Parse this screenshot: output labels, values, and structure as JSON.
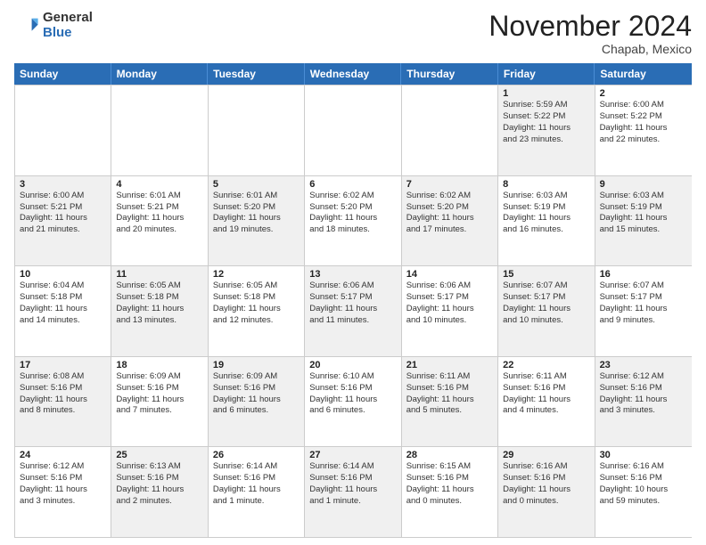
{
  "logo": {
    "general": "General",
    "blue": "Blue"
  },
  "title": "November 2024",
  "location": "Chapab, Mexico",
  "days_of_week": [
    "Sunday",
    "Monday",
    "Tuesday",
    "Wednesday",
    "Thursday",
    "Friday",
    "Saturday"
  ],
  "weeks": [
    [
      {
        "day": "",
        "info": ""
      },
      {
        "day": "",
        "info": ""
      },
      {
        "day": "",
        "info": ""
      },
      {
        "day": "",
        "info": ""
      },
      {
        "day": "",
        "info": ""
      },
      {
        "day": "1",
        "info": "Sunrise: 5:59 AM\nSunset: 5:22 PM\nDaylight: 11 hours\nand 23 minutes."
      },
      {
        "day": "2",
        "info": "Sunrise: 6:00 AM\nSunset: 5:22 PM\nDaylight: 11 hours\nand 22 minutes."
      }
    ],
    [
      {
        "day": "3",
        "info": "Sunrise: 6:00 AM\nSunset: 5:21 PM\nDaylight: 11 hours\nand 21 minutes."
      },
      {
        "day": "4",
        "info": "Sunrise: 6:01 AM\nSunset: 5:21 PM\nDaylight: 11 hours\nand 20 minutes."
      },
      {
        "day": "5",
        "info": "Sunrise: 6:01 AM\nSunset: 5:20 PM\nDaylight: 11 hours\nand 19 minutes."
      },
      {
        "day": "6",
        "info": "Sunrise: 6:02 AM\nSunset: 5:20 PM\nDaylight: 11 hours\nand 18 minutes."
      },
      {
        "day": "7",
        "info": "Sunrise: 6:02 AM\nSunset: 5:20 PM\nDaylight: 11 hours\nand 17 minutes."
      },
      {
        "day": "8",
        "info": "Sunrise: 6:03 AM\nSunset: 5:19 PM\nDaylight: 11 hours\nand 16 minutes."
      },
      {
        "day": "9",
        "info": "Sunrise: 6:03 AM\nSunset: 5:19 PM\nDaylight: 11 hours\nand 15 minutes."
      }
    ],
    [
      {
        "day": "10",
        "info": "Sunrise: 6:04 AM\nSunset: 5:18 PM\nDaylight: 11 hours\nand 14 minutes."
      },
      {
        "day": "11",
        "info": "Sunrise: 6:05 AM\nSunset: 5:18 PM\nDaylight: 11 hours\nand 13 minutes."
      },
      {
        "day": "12",
        "info": "Sunrise: 6:05 AM\nSunset: 5:18 PM\nDaylight: 11 hours\nand 12 minutes."
      },
      {
        "day": "13",
        "info": "Sunrise: 6:06 AM\nSunset: 5:17 PM\nDaylight: 11 hours\nand 11 minutes."
      },
      {
        "day": "14",
        "info": "Sunrise: 6:06 AM\nSunset: 5:17 PM\nDaylight: 11 hours\nand 10 minutes."
      },
      {
        "day": "15",
        "info": "Sunrise: 6:07 AM\nSunset: 5:17 PM\nDaylight: 11 hours\nand 10 minutes."
      },
      {
        "day": "16",
        "info": "Sunrise: 6:07 AM\nSunset: 5:17 PM\nDaylight: 11 hours\nand 9 minutes."
      }
    ],
    [
      {
        "day": "17",
        "info": "Sunrise: 6:08 AM\nSunset: 5:16 PM\nDaylight: 11 hours\nand 8 minutes."
      },
      {
        "day": "18",
        "info": "Sunrise: 6:09 AM\nSunset: 5:16 PM\nDaylight: 11 hours\nand 7 minutes."
      },
      {
        "day": "19",
        "info": "Sunrise: 6:09 AM\nSunset: 5:16 PM\nDaylight: 11 hours\nand 6 minutes."
      },
      {
        "day": "20",
        "info": "Sunrise: 6:10 AM\nSunset: 5:16 PM\nDaylight: 11 hours\nand 6 minutes."
      },
      {
        "day": "21",
        "info": "Sunrise: 6:11 AM\nSunset: 5:16 PM\nDaylight: 11 hours\nand 5 minutes."
      },
      {
        "day": "22",
        "info": "Sunrise: 6:11 AM\nSunset: 5:16 PM\nDaylight: 11 hours\nand 4 minutes."
      },
      {
        "day": "23",
        "info": "Sunrise: 6:12 AM\nSunset: 5:16 PM\nDaylight: 11 hours\nand 3 minutes."
      }
    ],
    [
      {
        "day": "24",
        "info": "Sunrise: 6:12 AM\nSunset: 5:16 PM\nDaylight: 11 hours\nand 3 minutes."
      },
      {
        "day": "25",
        "info": "Sunrise: 6:13 AM\nSunset: 5:16 PM\nDaylight: 11 hours\nand 2 minutes."
      },
      {
        "day": "26",
        "info": "Sunrise: 6:14 AM\nSunset: 5:16 PM\nDaylight: 11 hours\nand 1 minute."
      },
      {
        "day": "27",
        "info": "Sunrise: 6:14 AM\nSunset: 5:16 PM\nDaylight: 11 hours\nand 1 minute."
      },
      {
        "day": "28",
        "info": "Sunrise: 6:15 AM\nSunset: 5:16 PM\nDaylight: 11 hours\nand 0 minutes."
      },
      {
        "day": "29",
        "info": "Sunrise: 6:16 AM\nSunset: 5:16 PM\nDaylight: 11 hours\nand 0 minutes."
      },
      {
        "day": "30",
        "info": "Sunrise: 6:16 AM\nSunset: 5:16 PM\nDaylight: 10 hours\nand 59 minutes."
      }
    ]
  ]
}
